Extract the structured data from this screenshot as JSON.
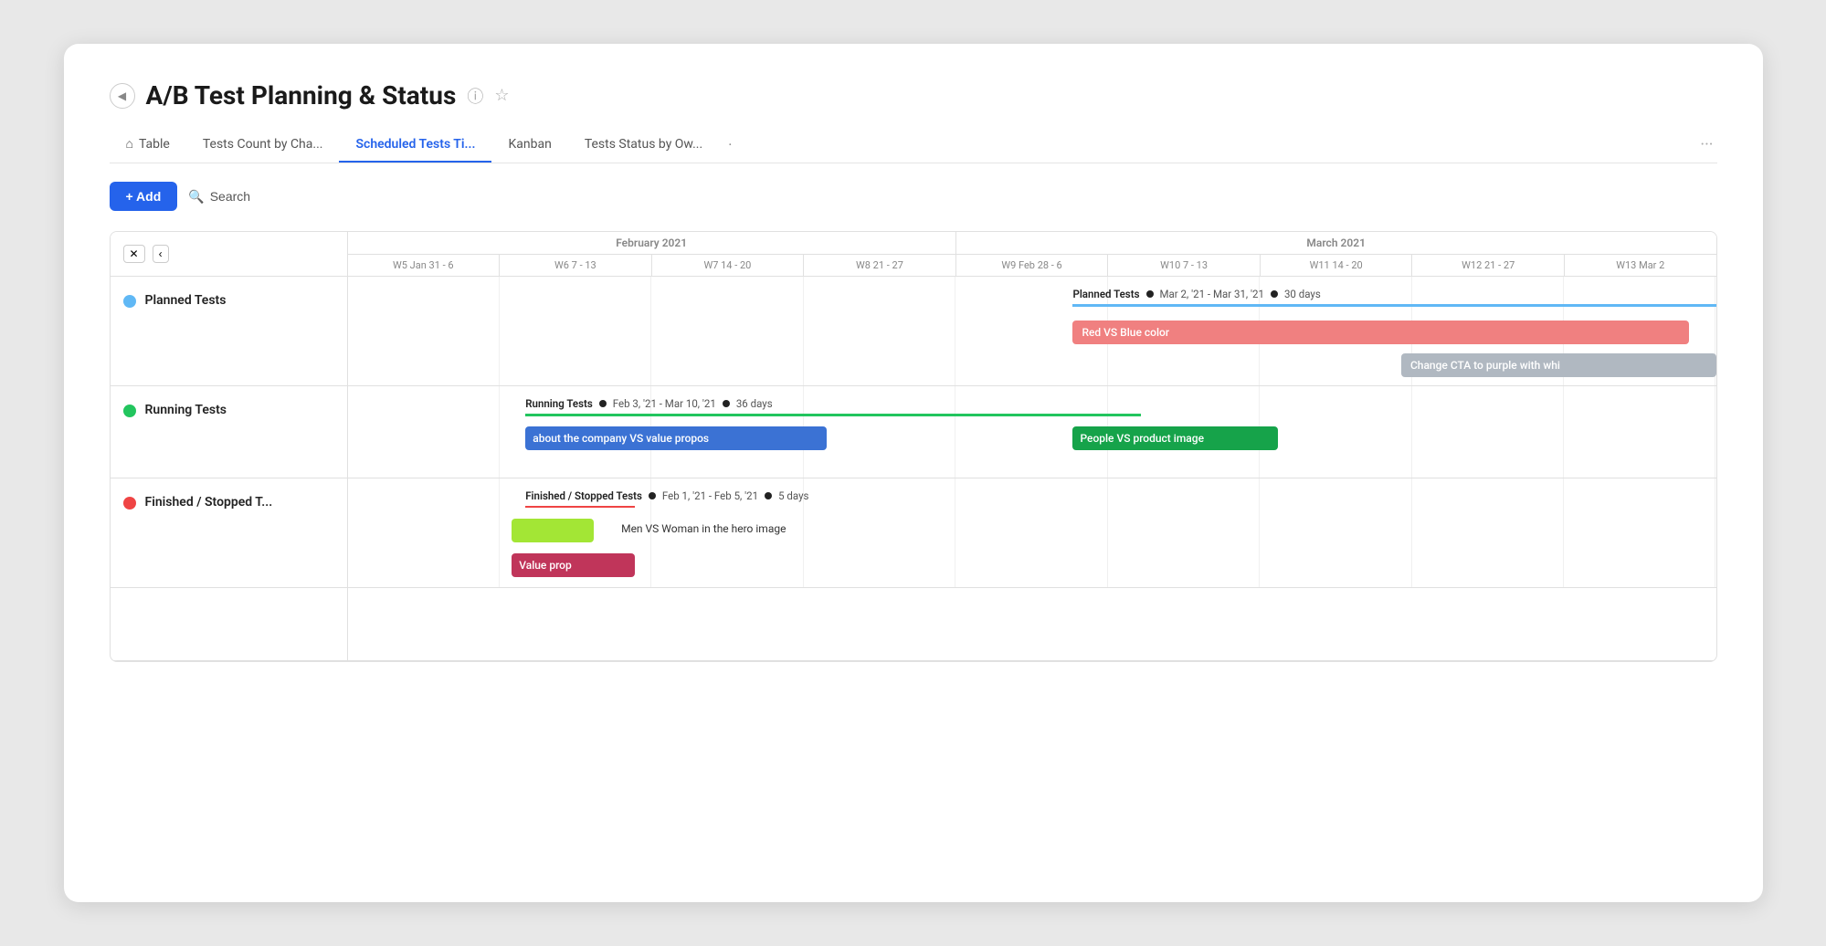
{
  "page": {
    "title": "A/B Test Planning & Status",
    "collapse_btn": "◀"
  },
  "tabs": [
    {
      "id": "table",
      "label": "Table",
      "icon": "⌂",
      "active": false
    },
    {
      "id": "tests-count",
      "label": "Tests Count by Cha...",
      "active": false
    },
    {
      "id": "scheduled",
      "label": "Scheduled Tests Ti...",
      "active": true
    },
    {
      "id": "kanban",
      "label": "Kanban",
      "active": false
    },
    {
      "id": "tests-status",
      "label": "Tests Status by Ow...",
      "active": false
    },
    {
      "id": "more",
      "label": "·",
      "active": false
    }
  ],
  "toolbar": {
    "add_label": "+ Add",
    "search_label": "Search"
  },
  "gantt": {
    "months": [
      {
        "label": "February 2021",
        "span": 4
      },
      {
        "label": "March 2021",
        "span": 5
      }
    ],
    "weeks": [
      "W5  Jan 31 - 6",
      "W6  7 - 13",
      "W7  14 - 20",
      "W8  21 - 27",
      "W9  Feb 28 - 6",
      "W10  7 - 13",
      "W11  14 - 20",
      "W12  21 - 27",
      "W13  Mar 2"
    ],
    "rows": [
      {
        "id": "planned",
        "label": "Planned Tests",
        "dot_color": "blue",
        "bars": {
          "timeline_label": "Planned Tests",
          "timeline_date": "Mar 2, '21 - Mar 31, '21",
          "timeline_days": "30 days",
          "bar1_label": "Red VS Blue color",
          "bar2_label": "Change CTA to purple with whi"
        }
      },
      {
        "id": "running",
        "label": "Running Tests",
        "dot_color": "green",
        "bars": {
          "timeline_label": "Running Tests",
          "timeline_date": "Feb 3, '21 - Mar 10, '21",
          "timeline_days": "36 days",
          "bar1_label": "about the company VS value propos",
          "bar2_label": "People VS product image"
        }
      },
      {
        "id": "finished",
        "label": "Finished / Stopped T...",
        "dot_color": "red",
        "bars": {
          "timeline_label": "Finished / Stopped Tests",
          "timeline_date": "Feb 1, '21 - Feb 5, '21",
          "timeline_days": "5 days",
          "bar1_label": "Men VS Woman in the hero image",
          "bar2_label": "Value prop"
        }
      }
    ]
  }
}
